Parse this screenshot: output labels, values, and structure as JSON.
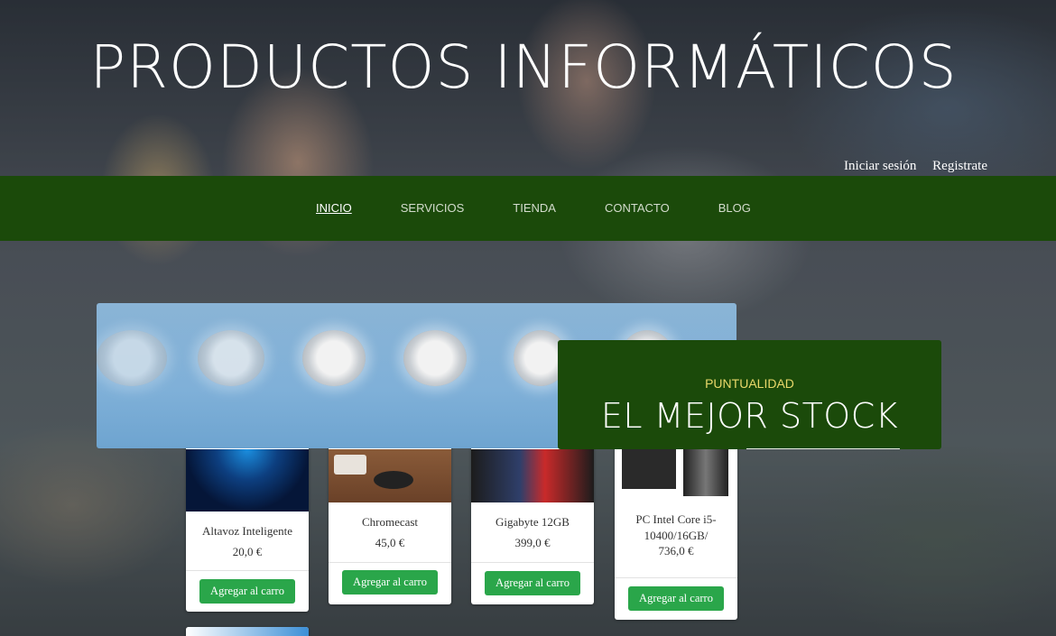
{
  "header": {
    "title": "PRODUCTOS INFORMÁTICOS",
    "login_label": "Iniciar sesión",
    "register_label": "Registrate"
  },
  "nav": {
    "items": [
      {
        "label": "INICIO",
        "active": true
      },
      {
        "label": "SERVICIOS",
        "active": false
      },
      {
        "label": "TIENDA",
        "active": false
      },
      {
        "label": "CONTACTO",
        "active": false
      },
      {
        "label": "BLOG",
        "active": false
      }
    ]
  },
  "slider": {
    "caption_small": "PUNTUALIDAD",
    "caption_big": "EL MEJOR STOCK"
  },
  "products": [
    {
      "name": "Altavoz Inteligente",
      "price": "20,0 €",
      "button": "Agregar al carro"
    },
    {
      "name": "Chromecast",
      "price": "45,0 €",
      "button": "Agregar al carro"
    },
    {
      "name": "Gigabyte 12GB",
      "price": "399,0 €",
      "button": "Agregar al carro"
    },
    {
      "name": "PC Intel Core i5-10400/16GB/",
      "price": "736,0 €",
      "button": "Agregar al carro"
    }
  ],
  "colors": {
    "navbar": "#1b4a0a",
    "caption_accent": "#e9d86a",
    "button": "#2aa64a"
  }
}
